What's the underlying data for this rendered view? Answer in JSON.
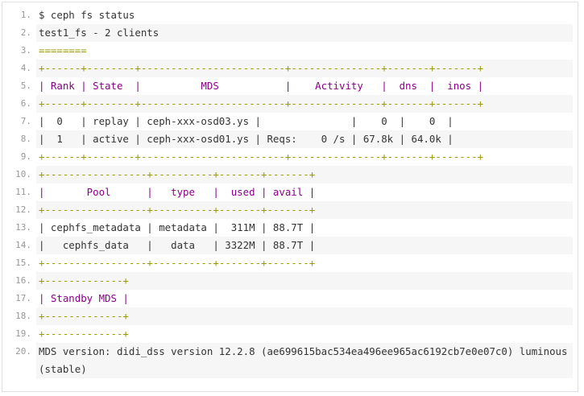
{
  "code": {
    "lines": [
      {
        "no": "1.",
        "text": "$ ceph fs status"
      },
      {
        "no": "2.",
        "text": "test1_fs - 2 clients"
      },
      {
        "no": "3.",
        "text": "========"
      },
      {
        "no": "4.",
        "text": "+------+--------+------------------------+---------------+-------+-------+"
      },
      {
        "no": "5.",
        "text": "| Rank | State  |          MDS           |    Activity   |  dns  |  inos |"
      },
      {
        "no": "6.",
        "text": "+------+--------+------------------------+---------------+-------+-------+"
      },
      {
        "no": "7.",
        "text": "|  0   | replay | ceph-xxx-osd03.ys |               |    0  |    0  |"
      },
      {
        "no": "8.",
        "text": "|  1   | active | ceph-xxx-osd01.ys | Reqs:    0 /s | 67.8k | 64.0k |"
      },
      {
        "no": "9.",
        "text": "+------+--------+------------------------+---------------+-------+-------+"
      },
      {
        "no": "10.",
        "text": "+-----------------+----------+-------+-------+"
      },
      {
        "no": "11.",
        "text": "|       Pool      |   type   |  used | avail |"
      },
      {
        "no": "12.",
        "text": "+-----------------+----------+-------+-------+"
      },
      {
        "no": "13.",
        "text": "| cephfs_metadata | metadata |  311M | 88.7T |"
      },
      {
        "no": "14.",
        "text": "|   cephfs_data   |   data   | 3322M | 88.7T |"
      },
      {
        "no": "15.",
        "text": "+-----------------+----------+-------+-------+"
      },
      {
        "no": "16.",
        "text": "+-------------+"
      },
      {
        "no": "17.",
        "text": "| Standby MDS |"
      },
      {
        "no": "18.",
        "text": "+-------------+"
      },
      {
        "no": "19.",
        "text": "+-------------+"
      },
      {
        "no": "20.",
        "text": "MDS version: didi_dss version 12.2.8 (ae699615bac534ea496ee965ac6192cb7e0e07c0) luminous (stable)"
      }
    ]
  }
}
